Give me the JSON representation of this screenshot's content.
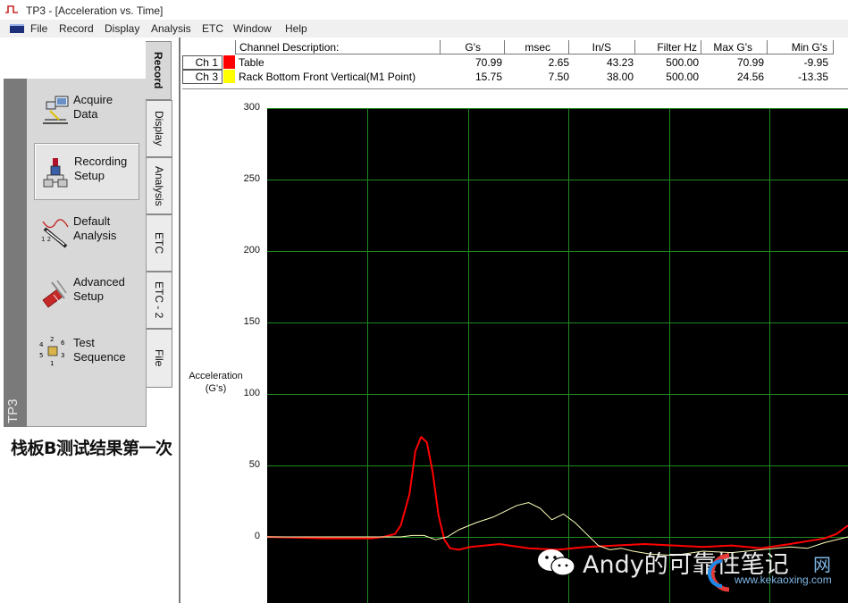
{
  "window": {
    "title": "TP3 - [Acceleration vs. Time]"
  },
  "menu": [
    "File",
    "Record",
    "Display",
    "Analysis",
    "ETC",
    "Window",
    "Help"
  ],
  "sidebar": {
    "strip_label": "TP3",
    "buttons": [
      {
        "label": "Acquire Data",
        "icon": "acquire-data-icon",
        "pressed": false
      },
      {
        "label": "Recording Setup",
        "icon": "recording-setup-icon",
        "pressed": true
      },
      {
        "label": "Default Analysis",
        "icon": "default-analysis-icon",
        "pressed": false
      },
      {
        "label": "Advanced Setup",
        "icon": "advanced-setup-icon",
        "pressed": false
      },
      {
        "label": "Test Sequence",
        "icon": "test-sequence-icon",
        "pressed": false
      }
    ],
    "tabs": [
      "Record",
      "Display",
      "Analysis",
      "ETC",
      "ETC - 2",
      "File"
    ],
    "active_tab": "Record"
  },
  "caption": "栈板B测试结果第一次",
  "channels": {
    "headers": [
      "Channel Description:",
      "G's",
      "msec",
      "In/S",
      "Filter Hz",
      "Max G's",
      "Min G's"
    ],
    "rows": [
      {
        "ch": "Ch 1",
        "color": "#ff0000",
        "desc": "Table",
        "g": "70.99",
        "msec": "2.65",
        "ins": "43.23",
        "filter": "500.00",
        "max": "70.99",
        "min": "-9.95"
      },
      {
        "ch": "Ch 3",
        "color": "#ffff00",
        "desc": "Rack Bottom Front Vertical(M1 Point)",
        "g": "15.75",
        "msec": "7.50",
        "ins": "38.00",
        "filter": "500.00",
        "max": "24.56",
        "min": "-13.35"
      }
    ]
  },
  "chart_data": {
    "type": "line",
    "ylabel": "Acceleration\n(G's)",
    "yticks": [
      "300",
      "250",
      "200",
      "150",
      "100",
      "50",
      "0"
    ],
    "ylim": [
      -45,
      300
    ],
    "xlim": [
      0,
      10
    ],
    "grid": true,
    "background": "#000000",
    "grid_color": "#1f8a1f",
    "series": [
      {
        "color": "#ff0000",
        "x": [
          0,
          1.0,
          1.8,
          2.0,
          2.2,
          2.3,
          2.45,
          2.55,
          2.65,
          2.75,
          2.85,
          2.95,
          3.05,
          3.15,
          3.3,
          3.5,
          4.0,
          4.5,
          5.0,
          5.5,
          6.0,
          6.5,
          7.0,
          7.5,
          8.0,
          8.5,
          9.0,
          9.3,
          9.6,
          9.8,
          10.0
        ],
        "y": [
          0,
          -1,
          -1,
          0,
          2,
          8,
          30,
          60,
          70,
          66,
          45,
          15,
          -2,
          -8,
          -9,
          -7,
          -5,
          -8,
          -9,
          -7,
          -6,
          -5,
          -6,
          -7,
          -6,
          -8,
          -5,
          -3,
          -1,
          2,
          8
        ]
      },
      {
        "color": "#ffffbb",
        "x": [
          0,
          1.5,
          2.0,
          2.3,
          2.5,
          2.7,
          2.9,
          3.1,
          3.3,
          3.6,
          3.9,
          4.1,
          4.3,
          4.5,
          4.7,
          4.9,
          5.1,
          5.3,
          5.5,
          5.7,
          5.9,
          6.1,
          6.3,
          6.6,
          7.0,
          7.5,
          8.0,
          8.5,
          9.0,
          9.3,
          9.6,
          10.0
        ],
        "y": [
          0,
          0,
          0,
          0,
          1,
          1,
          -2,
          0,
          5,
          10,
          14,
          18,
          22,
          24,
          20,
          12,
          16,
          10,
          2,
          -6,
          -9,
          -8,
          -10,
          -12,
          -13,
          -10,
          -11,
          -9,
          -7,
          -8,
          -4,
          0
        ]
      }
    ]
  }
}
